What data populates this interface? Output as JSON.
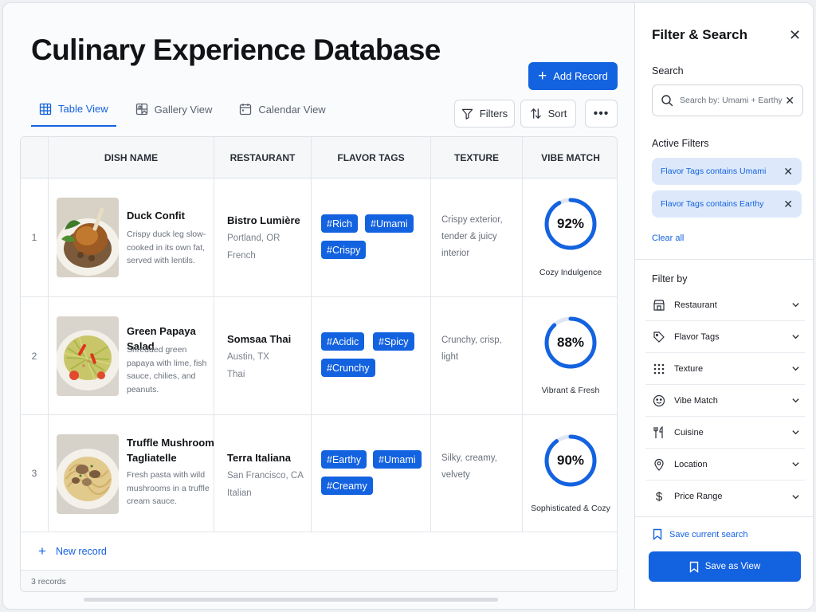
{
  "page": {
    "title": "Culinary Experience Database",
    "add_record": "Add Record"
  },
  "tabs": [
    {
      "label": "Table View",
      "icon": "table-icon",
      "active": true
    },
    {
      "label": "Gallery View",
      "icon": "gallery-icon",
      "active": false
    },
    {
      "label": "Calendar View",
      "icon": "calendar-icon",
      "active": false
    }
  ],
  "toolbar": {
    "filters": "Filters",
    "sort": "Sort",
    "more": "•••"
  },
  "table": {
    "columns": [
      "DISH NAME",
      "RESTAURANT",
      "FLAVOR TAGS",
      "TEXTURE",
      "VIBE MATCH"
    ],
    "rows": [
      {
        "num": "1",
        "dish": "Duck Confit",
        "desc": "Crispy duck leg slow-cooked in its own fat, served with lentils.",
        "restaurant": "Bistro Lumière",
        "location": "Portland, OR",
        "cuisine": "French",
        "tags": [
          "#Rich",
          "#Umami",
          "#Crispy"
        ],
        "texture": "Crispy exterior, tender & juicy interior",
        "vibe_value": 92,
        "vibe_text": "92%",
        "vibe_label": "Cozy Indulgence"
      },
      {
        "num": "2",
        "dish": "Green Papaya Salad",
        "desc": "Shredded green papaya with lime, fish sauce, chilies, and peanuts.",
        "restaurant": "Somsaa Thai",
        "location": "Austin, TX",
        "cuisine": "Thai",
        "tags": [
          "#Acidic",
          "#Spicy",
          "#Crunchy"
        ],
        "texture": "Crunchy, crisp, light",
        "vibe_value": 88,
        "vibe_text": "88%",
        "vibe_label": "Vibrant & Fresh"
      },
      {
        "num": "3",
        "dish": "Truffle Mushroom Tagliatelle",
        "desc": "Fresh pasta with wild mushrooms in a truffle cream sauce.",
        "restaurant": "Terra Italiana",
        "location": "San Francisco, CA",
        "cuisine": "Italian",
        "tags": [
          "#Earthy",
          "#Umami",
          "#Creamy"
        ],
        "texture": "Silky, creamy, velvety",
        "vibe_value": 90,
        "vibe_text": "90%",
        "vibe_label": "Sophisticated & Cozy"
      }
    ],
    "new_record": "New record",
    "footer_count": "3 records"
  },
  "side": {
    "title": "Filter & Search",
    "search_label": "Search",
    "search_placeholder": "Search by: Umami + Earthy",
    "active_filters_label": "Active Filters",
    "active_filters": [
      "Flavor Tags contains Umami",
      "Flavor Tags contains Earthy"
    ],
    "clear_all": "Clear all",
    "filter_by_label": "Filter by",
    "filters": [
      {
        "label": "Restaurant",
        "icon": "storefront-icon"
      },
      {
        "label": "Flavor Tags",
        "icon": "tag-icon"
      },
      {
        "label": "Texture",
        "icon": "dots-grid-icon"
      },
      {
        "label": "Vibe Match",
        "icon": "smiley-icon"
      },
      {
        "label": "Cuisine",
        "icon": "utensils-icon"
      },
      {
        "label": "Location",
        "icon": "location-pin-icon"
      },
      {
        "label": "Price Range",
        "icon": "dollar-icon"
      }
    ],
    "save_search": "Save current search",
    "save_view": "Save as View"
  },
  "colors": {
    "accent": "#1362e0",
    "chip_bg": "#dde9fb",
    "ring_track": "#dfe6f2"
  }
}
